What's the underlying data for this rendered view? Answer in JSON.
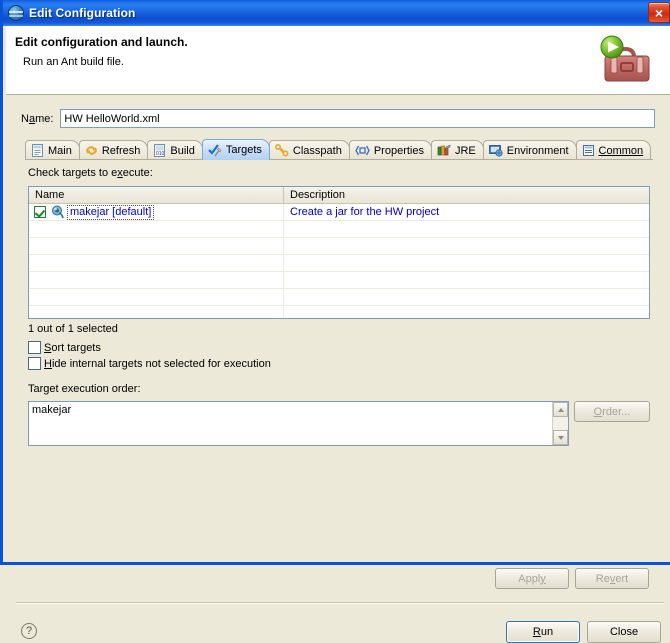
{
  "window": {
    "title": "Edit Configuration",
    "title_icon": "eclipse-globe-icon",
    "close_label": "×"
  },
  "banner": {
    "heading": "Edit configuration and launch.",
    "subtext": "Run an Ant build file.",
    "icon": "ant-toolbox-launch-icon"
  },
  "name_field": {
    "label_pre": "N",
    "label_accel": "a",
    "label_post": "me:",
    "value": "HW HelloWorld.xml",
    "placeholder": ""
  },
  "tabs": [
    {
      "label": "Main",
      "icon": "main-document-icon",
      "active": false
    },
    {
      "label": "Refresh",
      "icon": "refresh-arrows-icon",
      "active": false
    },
    {
      "label": "Build",
      "icon": "build-binary-icon",
      "active": false
    },
    {
      "label": "Targets",
      "icon": "targets-checkmark-icon",
      "active": true
    },
    {
      "label": "Classpath",
      "icon": "classpath-keys-icon",
      "active": false
    },
    {
      "label": "Properties",
      "icon": "properties-brackets-icon",
      "active": false
    },
    {
      "label": "JRE",
      "icon": "jre-books-icon",
      "active": false
    },
    {
      "label": "Environment",
      "icon": "environment-monitor-icon",
      "active": false
    },
    {
      "label": "Common",
      "icon": "common-list-icon",
      "active": false
    }
  ],
  "targets_panel": {
    "instruction_pre": "Check targets to e",
    "instruction_accel": "x",
    "instruction_post": "ecute:",
    "columns": [
      "Name",
      "Description"
    ],
    "rows": [
      {
        "checked": true,
        "icon": "ant-target-icon",
        "name": "makejar [default]",
        "description": "Create a jar for the HW project",
        "selected": true
      }
    ],
    "empty_row_count": 6,
    "selection_summary": "1 out of 1 selected",
    "sort_targets": {
      "checked": false,
      "label_accel": "S",
      "label_post": "ort targets"
    },
    "hide_internal": {
      "checked": false,
      "label_accel": "H",
      "label_post": "ide internal targets not selected for execution"
    },
    "execution_order_label": "Target execution order:",
    "execution_order_value": "makejar",
    "order_button": {
      "label_accel": "O",
      "label_post": "rder...",
      "enabled": false
    }
  },
  "footer": {
    "apply": {
      "label_pre": "Appl",
      "label_accel": "y",
      "label_post": "",
      "enabled": false
    },
    "revert": {
      "label_pre": "Re",
      "label_accel": "v",
      "label_post": "ert",
      "enabled": false
    },
    "help_icon": "help-question-icon",
    "run": {
      "label_pre": "",
      "label_accel": "R",
      "label_post": "un",
      "enabled": true,
      "default": true
    },
    "close": {
      "label_pre": "",
      "label_accel": "",
      "label_post": "Close",
      "enabled": true
    }
  },
  "colors": {
    "titlebar_blue": "#1966e2",
    "dialog_face": "#ece9d8",
    "field_border": "#7f9db9",
    "link_text": "#0000c8",
    "active_tab": "#c6ddf5",
    "close_red": "#cc2a10"
  }
}
